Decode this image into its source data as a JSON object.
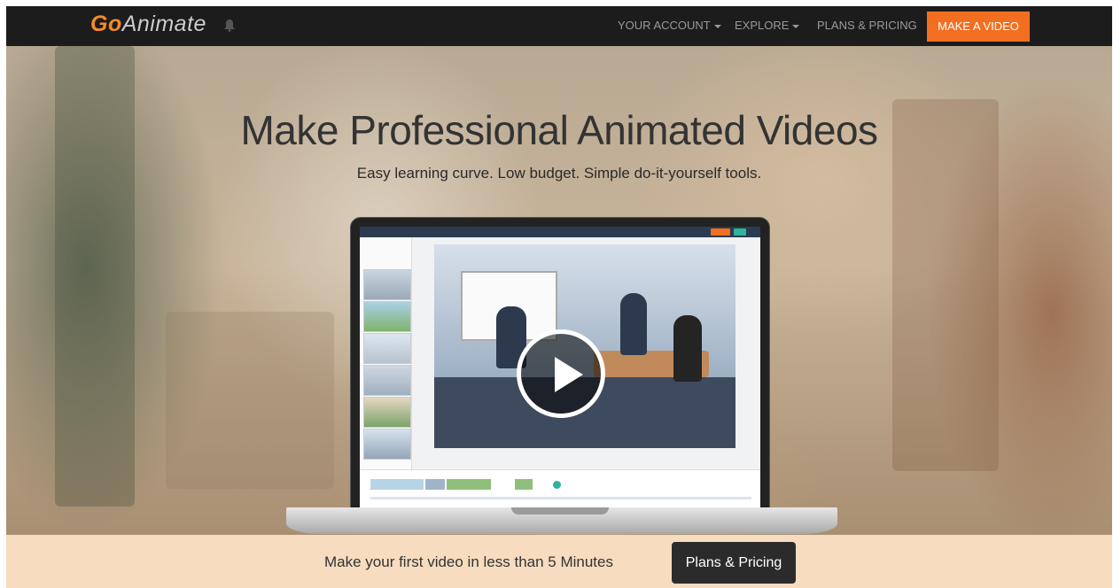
{
  "brand": {
    "logo_go": "Go",
    "logo_animate": "Animate",
    "accent": "#f26f21"
  },
  "nav": {
    "items": [
      {
        "label": "YOUR ACCOUNT",
        "dropdown": true
      },
      {
        "label": "EXPLORE",
        "dropdown": true
      },
      {
        "label": "PLANS & PRICING",
        "dropdown": false
      }
    ],
    "cta_label": "MAKE A VIDEO"
  },
  "hero": {
    "headline": "Make Professional Animated Videos",
    "subheadline": "Easy learning curve. Low budget. Simple do-it-yourself tools.",
    "play_icon": "play-icon"
  },
  "band": {
    "text": "Make your first video in less than 5 Minutes",
    "button_label": "Plans & Pricing"
  }
}
